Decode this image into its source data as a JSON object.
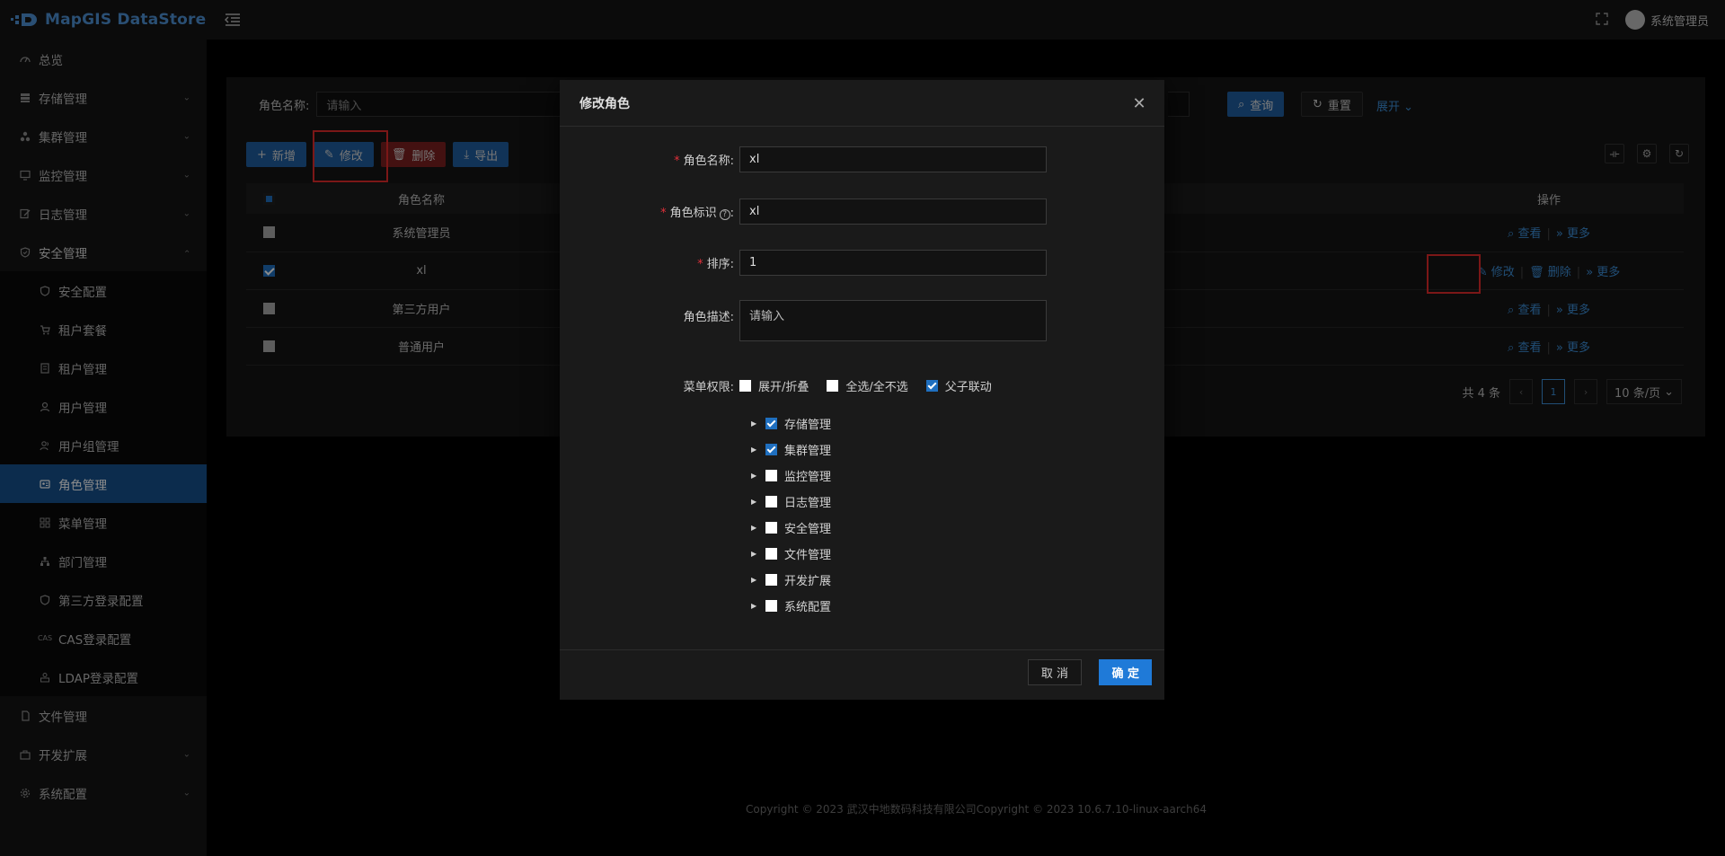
{
  "app": {
    "logo_text": "MapGIS DataStore"
  },
  "sidebar": {
    "items": [
      {
        "label": "总览"
      },
      {
        "label": "存储管理"
      },
      {
        "label": "集群管理"
      },
      {
        "label": "监控管理"
      },
      {
        "label": "日志管理"
      },
      {
        "label": "安全管理"
      }
    ],
    "security_sub": [
      {
        "label": "安全配置"
      },
      {
        "label": "租户套餐"
      },
      {
        "label": "租户管理"
      },
      {
        "label": "用户管理"
      },
      {
        "label": "用户组管理"
      },
      {
        "label": "角色管理"
      },
      {
        "label": "菜单管理"
      },
      {
        "label": "部门管理"
      },
      {
        "label": "第三方登录配置"
      },
      {
        "label": "CAS登录配置"
      },
      {
        "label": "LDAP登录配置"
      }
    ],
    "bottom_items": [
      {
        "label": "文件管理"
      },
      {
        "label": "开发扩展"
      },
      {
        "label": "系统配置"
      }
    ]
  },
  "header": {
    "username": "系统管理员"
  },
  "search": {
    "label": "角色名称:",
    "placeholder": "请输入",
    "query_label": "查询",
    "reset_label": "重置",
    "expand_label": "展开"
  },
  "toolbar": {
    "add_label": "新增",
    "edit_label": "修改",
    "delete_label": "删除",
    "export_label": "导出"
  },
  "table": {
    "col_name": "角色名称",
    "col_ops": "操作",
    "rows": [
      {
        "name": "系统管理员"
      },
      {
        "name": "xl"
      },
      {
        "name": "第三方用户"
      },
      {
        "name": "普通用户"
      }
    ],
    "op_view": "查看",
    "op_more": "更多",
    "op_edit": "修改",
    "op_delete": "删除"
  },
  "pagination": {
    "total": "共 4 条",
    "current": "1",
    "page_size": "10 条/页"
  },
  "footer": {
    "text": "Copyright © 2023 武汉中地数码科技有限公司Copyright © 2023 10.6.7.10-linux-aarch64"
  },
  "modal": {
    "title": "修改角色",
    "name_label": "角色名称:",
    "name_value": "xl",
    "key_label": "角色标识",
    "key_value": "xl",
    "sort_label": "排序:",
    "sort_value": "1",
    "desc_label": "角色描述:",
    "desc_placeholder": "请输入",
    "perm_label": "菜单权限:",
    "perm_options": [
      {
        "label": "展开/折叠",
        "checked": false
      },
      {
        "label": "全选/全不选",
        "checked": false
      },
      {
        "label": "父子联动",
        "checked": true
      }
    ],
    "tree": [
      {
        "label": "存储管理",
        "checked": true
      },
      {
        "label": "集群管理",
        "checked": true
      },
      {
        "label": "监控管理",
        "checked": false
      },
      {
        "label": "日志管理",
        "checked": false
      },
      {
        "label": "安全管理",
        "checked": false
      },
      {
        "label": "文件管理",
        "checked": false
      },
      {
        "label": "开发扩展",
        "checked": false
      },
      {
        "label": "系统配置",
        "checked": false
      }
    ],
    "cancel_label": "取 消",
    "ok_label": "确 定"
  },
  "colors": {
    "accent": "#1f7ad8",
    "active_menu": "#17508c",
    "danger": "#e02a2a"
  }
}
